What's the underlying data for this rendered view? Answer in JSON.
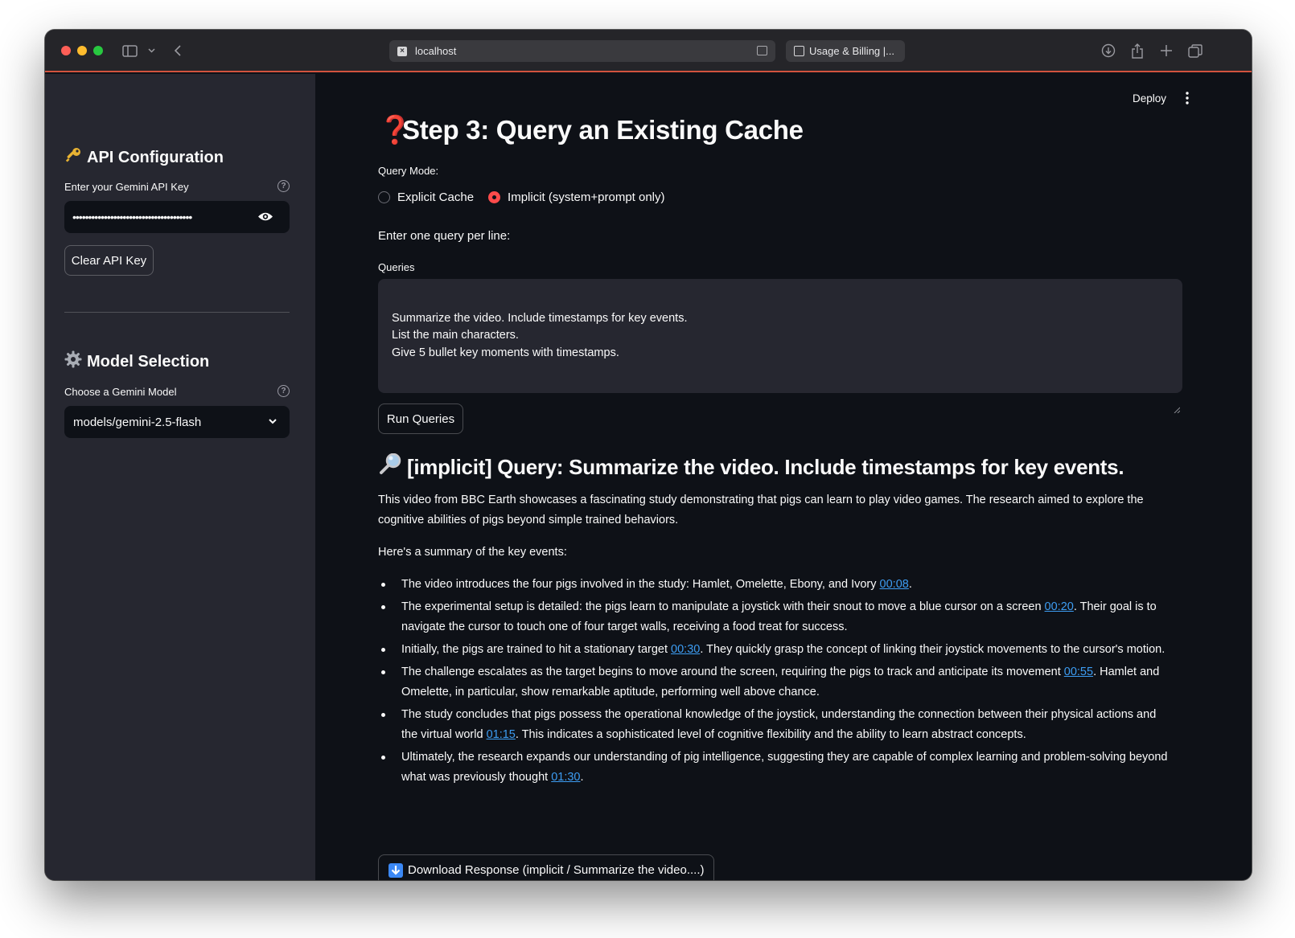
{
  "browser": {
    "url": "localhost",
    "tab_title": "Usage & Billing |..."
  },
  "sidebar": {
    "api_heading": "API Configuration",
    "api_key_label": "Enter your Gemini API Key",
    "api_key_value": "••••••••••••••••••••••••••••••••••••••",
    "clear_button": "Clear API Key",
    "model_heading": "Model Selection",
    "model_label": "Choose a Gemini Model",
    "model_value": "models/gemini-2.5-flash"
  },
  "header": {
    "deploy": "Deploy"
  },
  "main": {
    "title_icon": "❓",
    "title": "Step 3: Query an Existing Cache",
    "query_mode_label": "Query Mode:",
    "radio_explicit": "Explicit Cache",
    "radio_implicit": "Implicit (system+prompt only)",
    "instruction": "Enter one query per line:",
    "queries_label": "Queries",
    "queries_value": "Summarize the video. Include timestamps for key events.\nList the main characters.\nGive 5 bullet key moments with timestamps.",
    "run_button": "Run Queries",
    "result_title": "[implicit] Query: Summarize the video. Include timestamps for key events.",
    "intro": "This video from BBC Earth showcases a fascinating study demonstrating that pigs can learn to play video games. The research aimed to explore the cognitive abilities of pigs beyond simple trained behaviors.",
    "summary_heading": "Here's a summary of the key events:",
    "bullets": [
      {
        "before": "The video introduces the four pigs involved in the study: Hamlet, Omelette, Ebony, and Ivory ",
        "ts": "00:08",
        "after": "."
      },
      {
        "before": "The experimental setup is detailed: the pigs learn to manipulate a joystick with their snout to move a blue cursor on a screen ",
        "ts": "00:20",
        "after": ". Their goal is to navigate the cursor to touch one of four target walls, receiving a food treat for success."
      },
      {
        "before": "Initially, the pigs are trained to hit a stationary target ",
        "ts": "00:30",
        "after": ". They quickly grasp the concept of linking their joystick movements to the cursor's motion."
      },
      {
        "before": "The challenge escalates as the target begins to move around the screen, requiring the pigs to track and anticipate its movement ",
        "ts": "00:55",
        "after": ". Hamlet and Omelette, in particular, show remarkable aptitude, performing well above chance."
      },
      {
        "before": "The study concludes that pigs possess the operational knowledge of the joystick, understanding the connection between their physical actions and the virtual world ",
        "ts": "01:15",
        "after": ". This indicates a sophisticated level of cognitive flexibility and the ability to learn abstract concepts."
      },
      {
        "before": "Ultimately, the research expands our understanding of pig intelligence, suggesting they are capable of complex learning and problem-solving beyond what was previously thought ",
        "ts": "01:30",
        "after": "."
      }
    ],
    "download_button": "Download Response (implicit / Summarize the video....)"
  },
  "colors": {
    "accent": "#ff4b4b",
    "link": "#3d9df3",
    "sidebar_bg": "#262730",
    "main_bg": "#0e1117"
  }
}
